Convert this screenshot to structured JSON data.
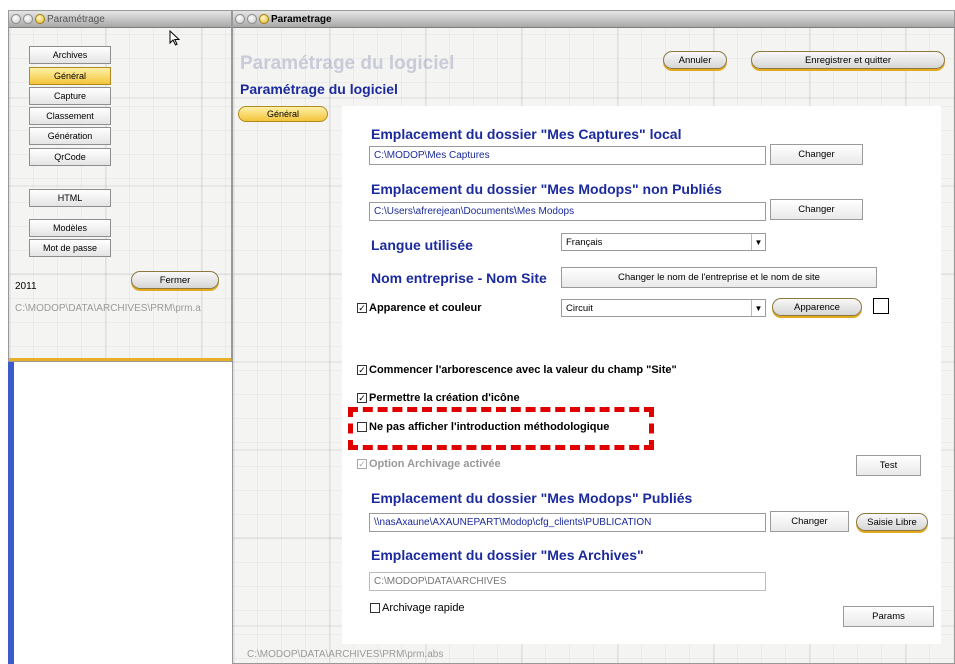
{
  "left_window": {
    "title": "Paramétrage",
    "nav": [
      "Archives",
      "Général",
      "Capture",
      "Classement",
      "Génération",
      "QrCode",
      "HTML",
      "Modèles",
      "Mot de passe"
    ],
    "year": "2011",
    "close_label": "Fermer",
    "path": "C:\\MODOP\\DATA\\ARCHIVES\\PRM\\prm.a"
  },
  "main_window": {
    "title": "Parametrage",
    "ghost_title": "Paramétrage du logiciel",
    "heading": "Paramétrage du logiciel",
    "cancel_label": "Annuler",
    "save_label": "Enregistrer et quitter",
    "tab_label": "Général",
    "captures_heading": "Emplacement du dossier \"Mes Captures\" local",
    "captures_path": "C:\\MODOP\\Mes Captures",
    "change_label": "Changer",
    "unpublished_heading": "Emplacement du dossier \"Mes Modops\" non Publiés",
    "unpublished_path": "C:\\Users\\afrerejean\\Documents\\Mes Modops",
    "language_label": "Langue utilisée",
    "language_value": "Français",
    "company_label": "Nom entreprise - Nom Site",
    "company_button": "Changer le nom de l'entreprise et le nom de site",
    "appearance_label": "Apparence et couleur",
    "appearance_value": "Circuit",
    "appearance_button": "Apparence",
    "tree_label": "Commencer l'arborescence avec la valeur du champ \"Site\"",
    "icon_label": "Permettre la création d'icône",
    "intro_label": "Ne pas afficher l'introduction méthodologique",
    "archive_option_label": "Option Archivage activée",
    "test_label": "Test",
    "published_heading": "Emplacement du dossier \"Mes Modops\" Publiés",
    "published_path": "\\\\nasAxaune\\AXAUNEPART\\Modop\\cfg_clients\\PUBLICATION",
    "free_entry_label": "Saisie Libre",
    "archives_heading": "Emplacement du dossier \"Mes Archives\"",
    "archives_path": "C:\\MODOP\\DATA\\ARCHIVES",
    "quick_archive_label": "Archivage rapide",
    "params_label": "Params",
    "footer_path": "C:\\MODOP\\DATA\\ARCHIVES\\PRM\\prm.abs"
  },
  "colors": {
    "accent": "#f3c43a",
    "heading": "#1b2a9c",
    "highlight": "#e00000",
    "strip": "#3b5bc8"
  }
}
